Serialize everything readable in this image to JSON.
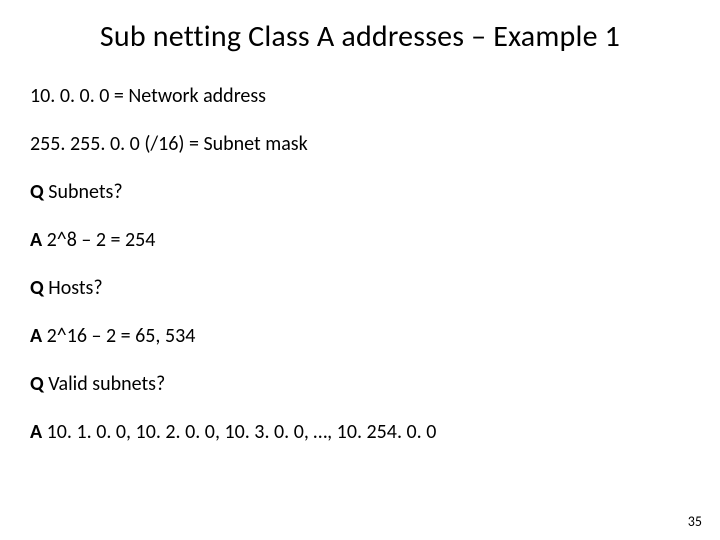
{
  "title": "Sub netting Class A addresses – Example 1",
  "lines": {
    "l0": {
      "text": "10. 0. 0. 0 = Network address"
    },
    "l1": {
      "text": "255. 255. 0. 0 (/16) = Subnet mask"
    },
    "l2": {
      "label": "Q",
      "text": " Subnets?"
    },
    "l3": {
      "label": "A",
      "text": " 2^8 – 2 = 254"
    },
    "l4": {
      "label": "Q",
      "text": " Hosts?"
    },
    "l5": {
      "label": "A",
      "text": " 2^16 – 2 = 65, 534"
    },
    "l6": {
      "label": "Q",
      "text": " Valid subnets?"
    },
    "l7": {
      "label": "A",
      "text": " 10. 1. 0. 0, 10. 2. 0. 0, 10. 3. 0. 0, …, 10. 254. 0. 0"
    }
  },
  "page_number": "35"
}
